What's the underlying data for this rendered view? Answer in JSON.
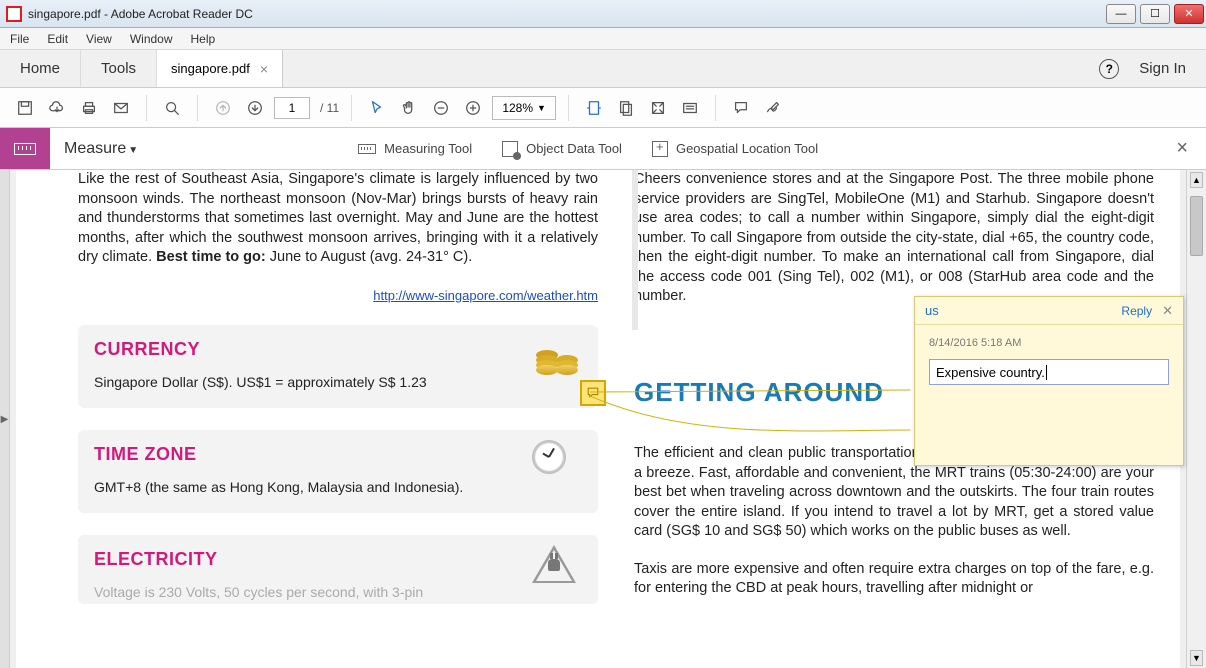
{
  "window": {
    "title": "singapore.pdf - Adobe Acrobat Reader DC"
  },
  "menubar": {
    "file": "File",
    "edit": "Edit",
    "view": "View",
    "window": "Window",
    "help": "Help"
  },
  "tabs": {
    "home": "Home",
    "tools": "Tools",
    "doc": "singapore.pdf",
    "signin": "Sign In"
  },
  "toolbar": {
    "page_current": "1",
    "page_total": "/ 11",
    "zoom": "128%"
  },
  "measurebar": {
    "title": "Measure",
    "measuring_tool": "Measuring Tool",
    "object_data_tool": "Object Data Tool",
    "geospatial_tool": "Geospatial Location Tool"
  },
  "doc": {
    "climate_para_prefix": "Like the rest of Southeast Asia, Singapore's climate is largely influenced by two monsoon winds. The northeast monsoon (Nov-Mar) brings bursts of heavy rain and thunderstorms that sometimes last overnight. May and June are the hottest months, after which the southwest monsoon arrives, bringing with it a relatively dry climate. ",
    "best_time_label": "Best time to go:",
    "best_time_value": " June to August (avg. 24-31° C).",
    "weather_link": "http://www-singapore.com/weather.htm",
    "currency": {
      "heading": "CURRENCY",
      "text": "Singapore Dollar (S$). US$1 = approximately S$ 1.23"
    },
    "timezone": {
      "heading": "TIME ZONE",
      "text": "GMT+8 (the same as Hong Kong, Malaysia and Indonesia)."
    },
    "electricity": {
      "heading": "ELECTRICITY",
      "text": "Voltage is 230 Volts, 50 cycles per second, with 3-pin"
    },
    "phones_para": "Cheers convenience stores and at the Singapore Post. The three mobile phone service providers are SingTel, MobileOne (M1) and Starhub. Singapore doesn't use area codes; to call a number within Singapore, simply dial the eight-digit number. To call Singapore from outside the city-state, dial +65, the country code, then the eight-digit number. To make an international call from Singapore, dial the access code 001 (Sing Tel), 002 (M1), or 008 (StarHub                                                      area code and the number.",
    "getting_around": "GETTING AROUND",
    "transport_para1": "The efficient and clean public transportation in Singapore makes getting around a breeze. Fast, affordable and convenient, the MRT trains (05:30-24:00) are your best bet when traveling across downtown and the outskirts. The four train routes cover the entire island. If you intend to travel a lot by MRT, get a stored value card (SG$ 10 and SG$ 50) which works on the public buses as well.",
    "transport_para2": "Taxis are more expensive and often require extra charges on top of the fare, e.g. for entering the CBD at peak hours, travelling after midnight or"
  },
  "comment": {
    "author": "us",
    "reply": "Reply",
    "date": "8/14/2016  5:18 AM",
    "text": "Expensive country."
  }
}
